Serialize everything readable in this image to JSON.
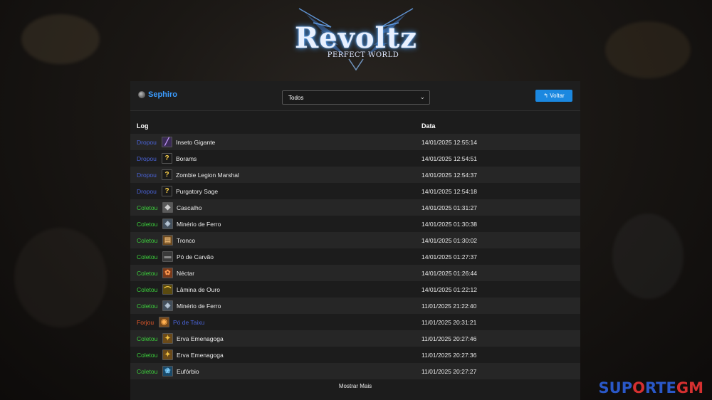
{
  "logo": {
    "title": "Revoltz",
    "subtitle": "PERFECT WORLD"
  },
  "colors": {
    "dropou": "#4a63d8",
    "coletou": "#3cd13c",
    "forjou": "#e65a2a",
    "accent": "#1b88e0"
  },
  "character": {
    "name": "Sephiro"
  },
  "filter": {
    "selected": "Todos"
  },
  "back_button": {
    "label": "↰ Voltar"
  },
  "table": {
    "headers": {
      "log": "Log",
      "date": "Data"
    },
    "rows": [
      {
        "action": "Dropou",
        "action_type": "dropou",
        "item": "Inseto Gigante",
        "icon": "insect-icon",
        "date": "14/01/2025 12:55:14"
      },
      {
        "action": "Dropou",
        "action_type": "dropou",
        "item": "Borams",
        "icon": "question-icon",
        "date": "14/01/2025 12:54:51"
      },
      {
        "action": "Dropou",
        "action_type": "dropou",
        "item": "Zombie Legion Marshal",
        "icon": "question-icon",
        "date": "14/01/2025 12:54:37"
      },
      {
        "action": "Dropou",
        "action_type": "dropou",
        "item": "Purgatory Sage",
        "icon": "question-icon",
        "date": "14/01/2025 12:54:18"
      },
      {
        "action": "Coletou",
        "action_type": "coletou",
        "item": "Cascalho",
        "icon": "gravel-icon",
        "date": "14/01/2025 01:31:27"
      },
      {
        "action": "Coletou",
        "action_type": "coletou",
        "item": "Minério de Ferro",
        "icon": "iron-ore-icon",
        "date": "14/01/2025 01:30:38"
      },
      {
        "action": "Coletou",
        "action_type": "coletou",
        "item": "Tronco",
        "icon": "log-icon",
        "date": "14/01/2025 01:30:02"
      },
      {
        "action": "Coletou",
        "action_type": "coletou",
        "item": "Pó de Carvão",
        "icon": "coal-icon",
        "date": "14/01/2025 01:27:37"
      },
      {
        "action": "Coletou",
        "action_type": "coletou",
        "item": "Néctar",
        "icon": "nectar-icon",
        "date": "14/01/2025 01:26:44"
      },
      {
        "action": "Coletou",
        "action_type": "coletou",
        "item": "Lâmina de Ouro",
        "icon": "gold-blade-icon",
        "date": "14/01/2025 01:22:12"
      },
      {
        "action": "Coletou",
        "action_type": "coletou",
        "item": "Minério de Ferro",
        "icon": "iron-ore-icon",
        "date": "11/01/2025 21:22:40"
      },
      {
        "action": "Forjou",
        "action_type": "forjou",
        "item": "Pó de Taixu",
        "icon": "taixu-powder-icon",
        "date": "11/01/2025 20:31:21"
      },
      {
        "action": "Coletou",
        "action_type": "coletou",
        "item": "Erva Emenagoga",
        "icon": "herb-icon",
        "date": "11/01/2025 20:27:46"
      },
      {
        "action": "Coletou",
        "action_type": "coletou",
        "item": "Erva Emenagoga",
        "icon": "herb-icon",
        "date": "11/01/2025 20:27:36"
      },
      {
        "action": "Coletou",
        "action_type": "coletou",
        "item": "Eufórbio",
        "icon": "euphorbia-icon",
        "date": "11/01/2025 20:27:27"
      }
    ]
  },
  "show_more": {
    "label": "Mostrar Mais"
  },
  "watermark": {
    "part1": "SUP",
    "part2": "O",
    "part3": "RTE",
    "part4": "GM"
  }
}
